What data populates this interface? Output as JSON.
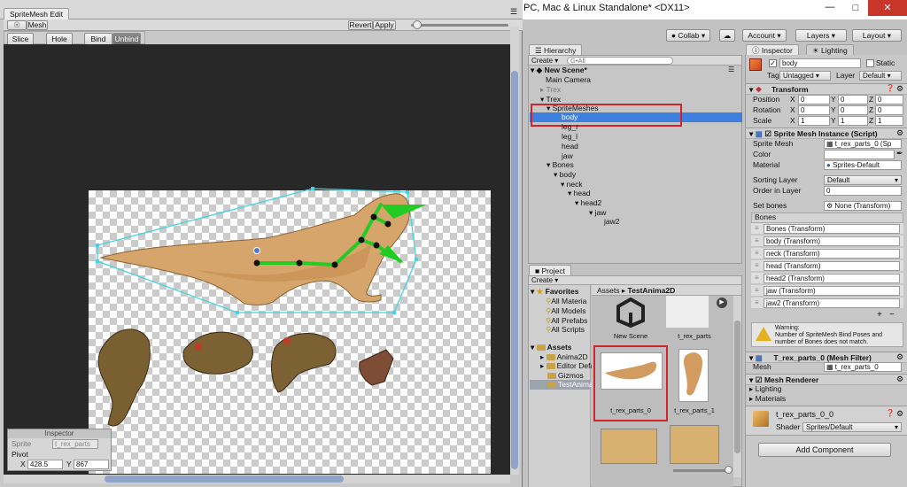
{
  "unity_title": "PC, Mac & Linux Standalone* <DX11>",
  "sm_editor": {
    "title": "SpriteMesh Edit",
    "tab_mesh": "Mesh",
    "btn_revert": "Revert",
    "btn_apply": "Apply",
    "btn_slice": "Slice",
    "btn_hole": "Hole",
    "btn_bind": "Bind",
    "btn_unbind": "Unbind",
    "inspector": {
      "title": "Inspector",
      "sprite_label": "Sprite",
      "sprite_value": "t_rex_parts",
      "pivot_label": "Pivot",
      "x_label": "X",
      "x_value": "428.5",
      "y_label": "Y",
      "y_value": "867"
    }
  },
  "toolbar": {
    "collab": "Collab",
    "account": "Account",
    "layers": "Layers",
    "layout": "Layout"
  },
  "hierarchy": {
    "title": "Hierarchy",
    "create": "Create",
    "search_placeholder": "G•All",
    "rows": [
      "New Scene*",
      "Main Camera",
      "Trex",
      "Trex",
      "SpriteMeshes",
      "body",
      "leg_r",
      "leg_l",
      "head",
      "jaw",
      "Bones",
      "body",
      "neck",
      "head",
      "head2",
      "jaw",
      "jaw2"
    ]
  },
  "project": {
    "title": "Project",
    "create": "Create",
    "favorites": "Favorites",
    "fav_items": [
      "All Materia",
      "All Models",
      "All Prefabs",
      "All Scripts"
    ],
    "assets": "Assets",
    "asset_items": [
      "Anima2D",
      "Editor Defa",
      "Gizmos",
      "TestAnima"
    ],
    "breadcrumb_root": "Assets",
    "breadcrumb_sep": "▸",
    "breadcrumb_leaf": "TestAnima2D",
    "tiles": [
      "New Scene",
      "t_rex_parts",
      "t_rex_parts_0",
      "t_rex_parts_1"
    ]
  },
  "inspector": {
    "tab_inspector": "Inspector",
    "tab_lighting": "Lighting",
    "object_name": "body",
    "static_label": "Static",
    "tag_label": "Tag",
    "tag_value": "Untagged",
    "layer_label": "Layer",
    "layer_value": "Default",
    "transform": {
      "title": "Transform",
      "position": "Position",
      "rotation": "Rotation",
      "scale": "Scale",
      "pos": [
        "0",
        "0",
        "0"
      ],
      "rot": [
        "0",
        "0",
        "0"
      ],
      "scl": [
        "1",
        "1",
        "1"
      ],
      "x": "X",
      "y": "Y",
      "z": "Z"
    },
    "smi": {
      "title": "Sprite Mesh Instance (Script)",
      "sprite_mesh_label": "Sprite Mesh",
      "sprite_mesh_value": "t_rex_parts_0 (Sp",
      "color_label": "Color",
      "material_label": "Material",
      "material_value": "Sprites-Default",
      "sorting_layer_label": "Sorting Layer",
      "sorting_layer_value": "Default",
      "order_label": "Order in Layer",
      "order_value": "0",
      "set_bones_label": "Set bones",
      "set_bones_value": "None (Transform)",
      "bones_header": "Bones",
      "bones": [
        "Bones (Transform)",
        "body (Transform)",
        "neck (Transform)",
        "head (Transform)",
        "head2 (Transform)",
        "jaw (Transform)",
        "jaw2 (Transform)"
      ],
      "warning": "Warning:\nNumber of SpriteMesh Bind Poses and number of Bones does not match."
    },
    "mesh_filter": {
      "title": "T_rex_parts_0 (Mesh Filter)",
      "mesh_label": "Mesh",
      "mesh_value": "t_rex_parts_0"
    },
    "mesh_renderer": {
      "title": "Mesh Renderer",
      "lighting": "Lighting",
      "materials": "Materials"
    },
    "material": {
      "name": "t_rex_parts_0_0",
      "shader_label": "Shader",
      "shader_value": "Sprites/Default"
    },
    "add_component": "Add Component"
  },
  "colors": {
    "selection": "#3d80df",
    "highlight_box": "#d2232a",
    "bone": "#22cc22",
    "mesh_outline": "#42d4e0"
  }
}
